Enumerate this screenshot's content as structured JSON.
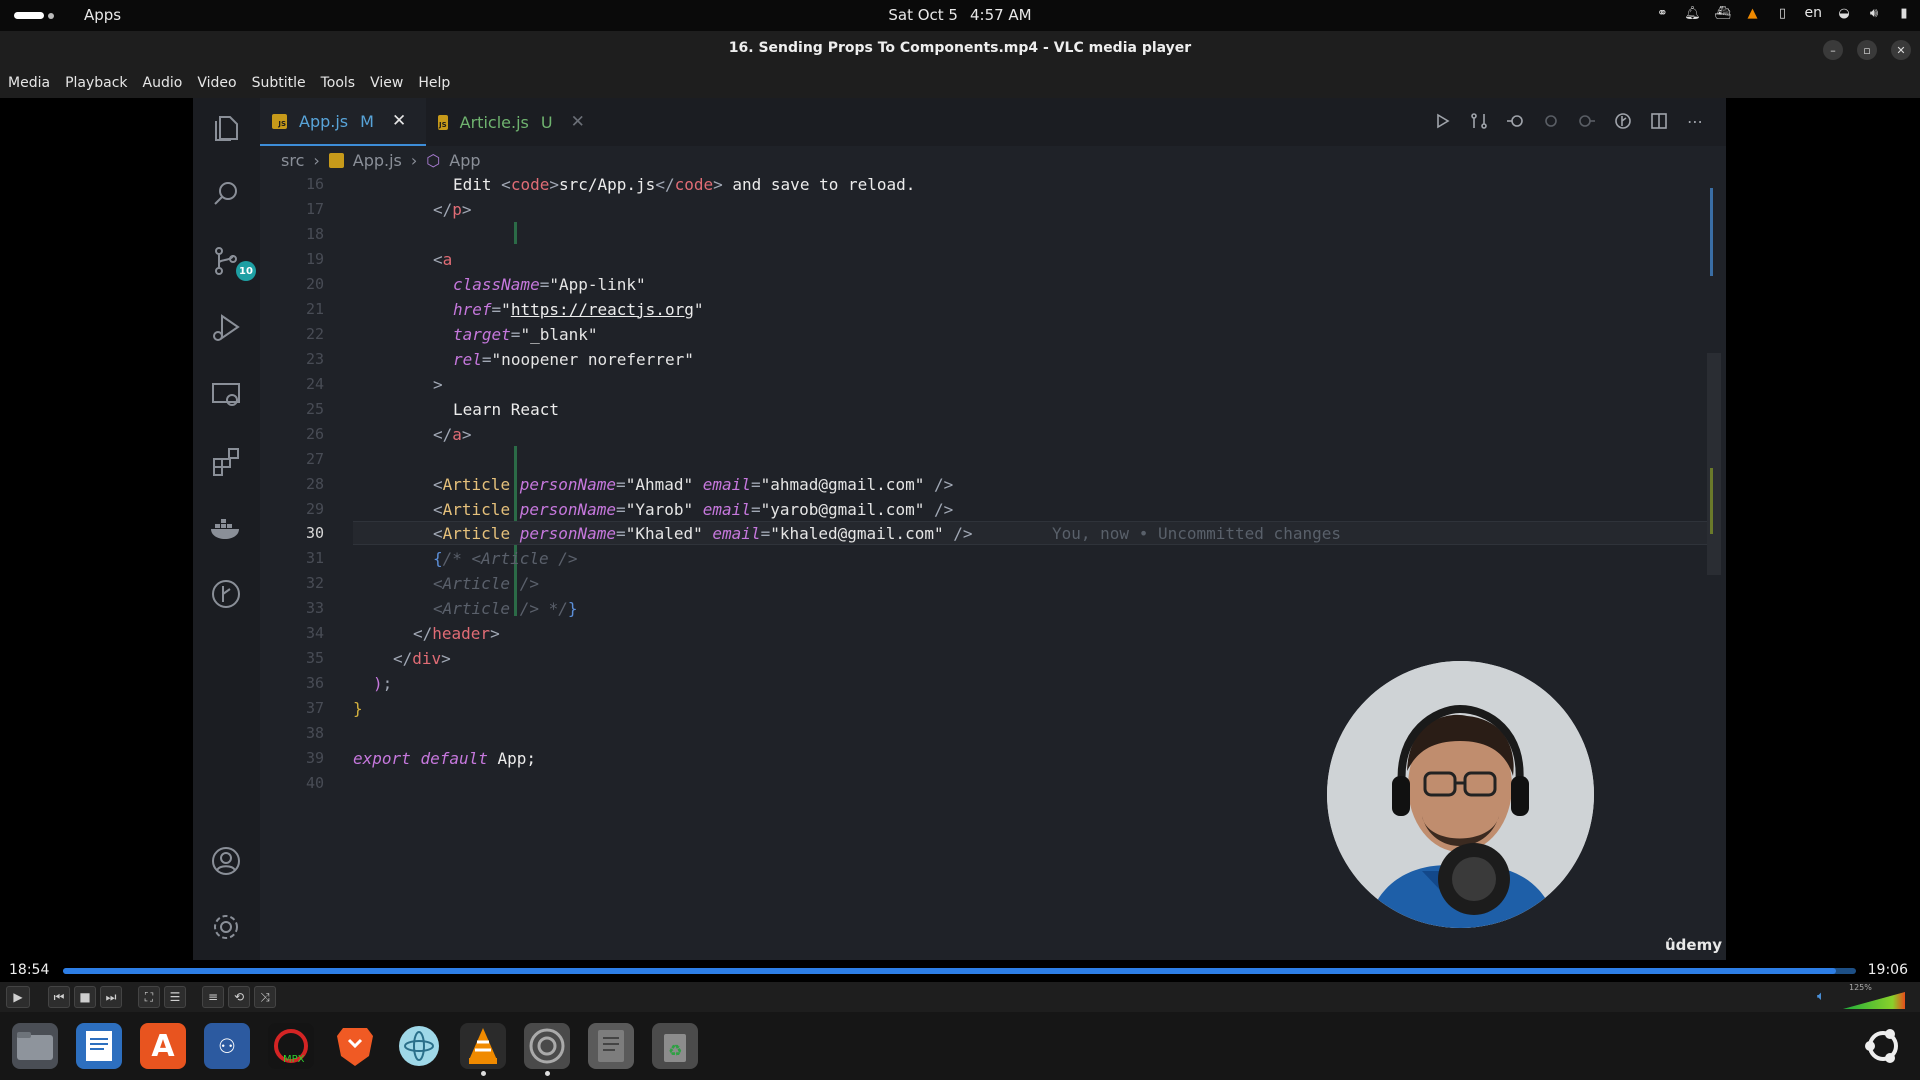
{
  "topbar": {
    "apps": "Apps",
    "date": "Sat Oct 5",
    "time": "4:57 AM",
    "lang": "en"
  },
  "window": {
    "title": "16. Sending Props To Components.mp4 - VLC media player"
  },
  "menu": [
    "Media",
    "Playback",
    "Audio",
    "Video",
    "Subtitle",
    "Tools",
    "View",
    "Help"
  ],
  "editor": {
    "tabs": [
      {
        "icon_text": "JS",
        "name": "App.js",
        "flag": "M",
        "close": "✕"
      },
      {
        "icon_text": "JS",
        "name": "Article.js",
        "flag": "U",
        "close": "✕"
      }
    ],
    "breadcrumb": {
      "folder": "src",
      "file": "App.js",
      "symbol": "App"
    },
    "scm_badge": "10",
    "line_numbers": [
      "16",
      "17",
      "18",
      "19",
      "20",
      "21",
      "22",
      "23",
      "24",
      "25",
      "26",
      "27",
      "28",
      "29",
      "30",
      "31",
      "32",
      "33",
      "34",
      "35",
      "36",
      "37",
      "38",
      "39",
      "40"
    ],
    "code": {
      "l16": [
        "Edit ",
        "<",
        "code",
        ">",
        "src/App.js",
        "</",
        "code",
        ">",
        " and save to reload."
      ],
      "l17": [
        "</",
        "p",
        ">"
      ],
      "l19": [
        "<",
        "a"
      ],
      "l20": [
        "className",
        "=",
        "\"App-link\""
      ],
      "l21": [
        "href",
        "=",
        "\"",
        "https://reactjs.org",
        "\""
      ],
      "l22": [
        "target",
        "=",
        "\"_blank\""
      ],
      "l23": [
        "rel",
        "=",
        "\"noopener noreferrer\""
      ],
      "l24": [
        ">"
      ],
      "l25": [
        "Learn React"
      ],
      "l26": [
        "</",
        "a",
        ">"
      ],
      "l28": [
        "<",
        "Article",
        "personName",
        "=",
        "\"Ahmad\"",
        "email",
        "=",
        "\"ahmad@gmail.com\"",
        "/>"
      ],
      "l29": [
        "<",
        "Article",
        "personName",
        "=",
        "\"Yarob\"",
        "email",
        "=",
        "\"yarob@gmail.com\"",
        "/>"
      ],
      "l30": [
        "<",
        "Article",
        "personName",
        "=",
        "\"Khaled\"",
        "email",
        "=",
        "\"khaled@gmail.com\"",
        "/>"
      ],
      "blame": "You, now • Uncommitted changes",
      "l31": [
        "{",
        "/* <Article />"
      ],
      "l32": [
        "<Article />"
      ],
      "l33": [
        "<Article /> */",
        "}"
      ],
      "l34": [
        "</",
        "header",
        ">"
      ],
      "l35": [
        "</",
        "div",
        ">"
      ],
      "l36": [
        ")",
        ";"
      ],
      "l37": [
        "}"
      ],
      "l39": [
        "export",
        "default",
        "App;"
      ]
    }
  },
  "player": {
    "current_time": "18:54",
    "total_time": "19:06",
    "progress": 0.989,
    "volume_label": "125%",
    "watermark": "ûdemy"
  }
}
